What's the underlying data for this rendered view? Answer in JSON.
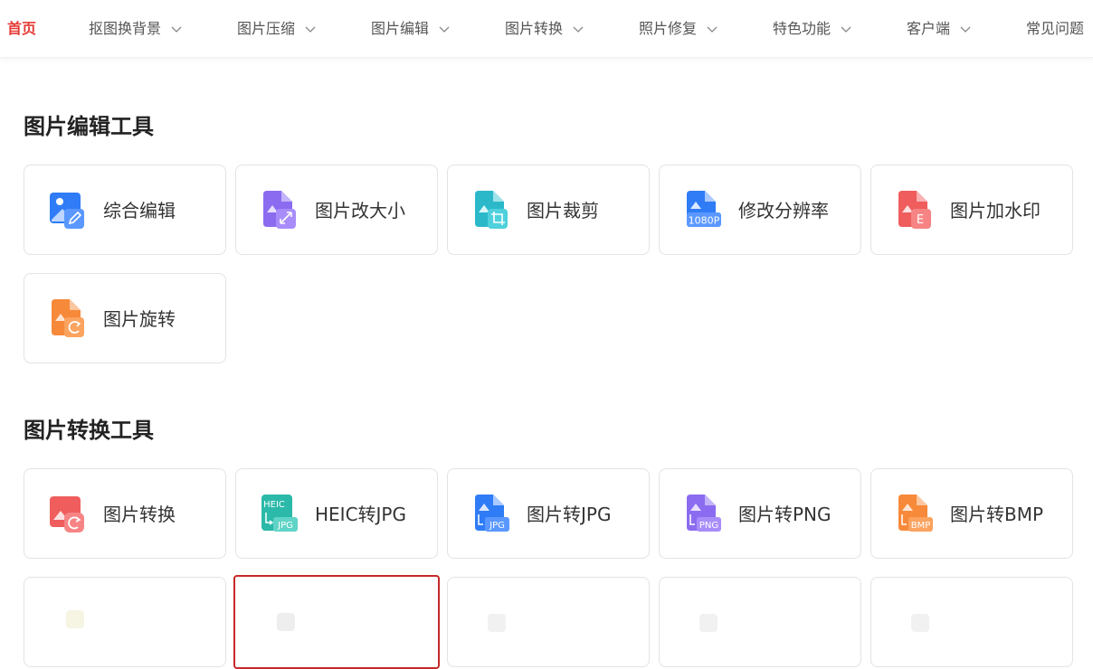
{
  "nav": {
    "items": [
      {
        "label": "首页",
        "active": true,
        "dropdown": false
      },
      {
        "label": "抠图换背景",
        "dropdown": true
      },
      {
        "label": "图片压缩",
        "dropdown": true
      },
      {
        "label": "图片编辑",
        "dropdown": true
      },
      {
        "label": "图片转换",
        "dropdown": true
      },
      {
        "label": "照片修复",
        "dropdown": true
      },
      {
        "label": "特色功能",
        "dropdown": true
      },
      {
        "label": "客户端",
        "dropdown": true
      },
      {
        "label": "常见问题",
        "dropdown": false
      }
    ]
  },
  "edit_section": {
    "title": "图片编辑工具",
    "tools": [
      {
        "label": "综合编辑",
        "icon": "image-edit-icon",
        "color": "#2f7cf6"
      },
      {
        "label": "图片改大小",
        "icon": "image-resize-icon",
        "color": "#8b6cf0"
      },
      {
        "label": "图片裁剪",
        "icon": "image-crop-icon",
        "color": "#2bb9c9"
      },
      {
        "label": "修改分辨率",
        "icon": "image-resolution-icon",
        "color": "#2f7cf6",
        "badge": "1080P"
      },
      {
        "label": "图片加水印",
        "icon": "image-watermark-icon",
        "color": "#ef5d5d",
        "badge": "E"
      },
      {
        "label": "图片旋转",
        "icon": "image-rotate-icon",
        "color": "#f7893a"
      }
    ]
  },
  "convert_section": {
    "title": "图片转换工具",
    "tools": [
      {
        "label": "图片转换",
        "icon": "image-convert-icon",
        "color": "#ef5d5d"
      },
      {
        "label": "HEIC转JPG",
        "icon": "heic-to-jpg-icon",
        "color": "#2bb9a9",
        "badge_top": "HEIC",
        "badge": "JPG"
      },
      {
        "label": "图片转JPG",
        "icon": "image-to-jpg-icon",
        "color": "#2f7cf6",
        "badge": "JPG"
      },
      {
        "label": "图片转PNG",
        "icon": "image-to-png-icon",
        "color": "#8b6cf0",
        "badge": "PNG"
      },
      {
        "label": "图片转BMP",
        "icon": "image-to-bmp-icon",
        "color": "#f7893a",
        "badge": "BMP"
      }
    ]
  }
}
